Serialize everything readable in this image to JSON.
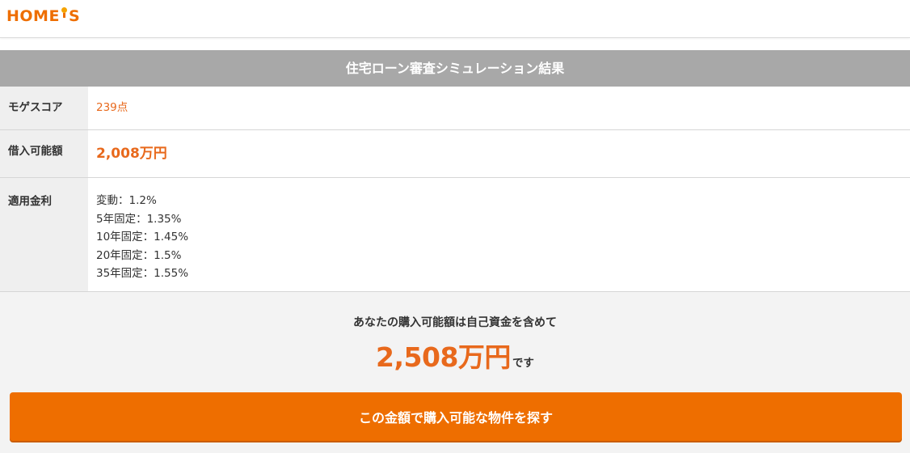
{
  "header": {
    "logo_text_before": "HOME",
    "logo_text_after": "S"
  },
  "result": {
    "title": "住宅ローン審査シミュレーション結果",
    "rows": [
      {
        "label": "モゲスコア",
        "value": "239点"
      },
      {
        "label": "借入可能額",
        "value": "2,008万円"
      },
      {
        "label": "適用金利",
        "rates": [
          "変動：1.2%",
          "5年固定：1.35%",
          "10年固定：1.45%",
          "20年固定：1.5%",
          "35年固定：1.55%"
        ]
      }
    ]
  },
  "summary": {
    "lead": "あなたの購入可能額は自己資金を含めて",
    "total": "2,508万円",
    "suffix": "です",
    "button_label": "この金額で購入可能な物件を探す"
  },
  "colors": {
    "accent": "#ee6e00",
    "value_orange": "#e8691c",
    "title_bar": "#a8a8a8",
    "label_bg": "#efefef",
    "summary_bg": "#f3f3f3"
  }
}
